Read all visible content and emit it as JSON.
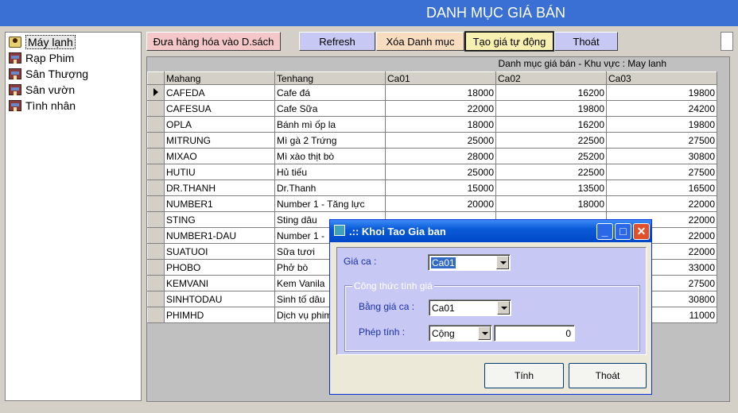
{
  "app": {
    "title": "DANH MỤC GIÁ BÁN"
  },
  "tree": {
    "items": [
      {
        "label": "Máy lạnh",
        "icon": "person-icon",
        "selected": true
      },
      {
        "label": "Rạp Phim",
        "icon": "house-icon"
      },
      {
        "label": "Sân Thượng",
        "icon": "house-icon"
      },
      {
        "label": "Sân vườn",
        "icon": "house-icon"
      },
      {
        "label": "Tình nhân",
        "icon": "house-icon"
      }
    ]
  },
  "toolbar": {
    "add_label": "Đưa hàng hóa vào D.sách",
    "refresh_label": "Refresh",
    "delete_label": "Xóa Danh mục",
    "auto_price_label": "Tạo giá tự động",
    "exit_label": "Thoát"
  },
  "grid": {
    "caption": "Danh mục giá bán - Khu vực : May lanh",
    "columns": [
      "Mahang",
      "Tenhang",
      "Ca01",
      "Ca02",
      "Ca03"
    ],
    "rows": [
      [
        "CAFEDA",
        "Cafe đá",
        "18000",
        "16200",
        "19800"
      ],
      [
        "CAFESUA",
        "Cafe Sữa",
        "22000",
        "19800",
        "24200"
      ],
      [
        "OPLA",
        "Bánh mì ốp la",
        "18000",
        "16200",
        "19800"
      ],
      [
        "MITRUNG",
        "Mì gà 2 Trứng",
        "25000",
        "22500",
        "27500"
      ],
      [
        "MIXAO",
        "Mì xào thịt bò",
        "28000",
        "25200",
        "30800"
      ],
      [
        "HUTIU",
        "Hủ tiếu",
        "25000",
        "22500",
        "27500"
      ],
      [
        "DR.THANH",
        "Dr.Thanh",
        "15000",
        "13500",
        "16500"
      ],
      [
        "NUMBER1",
        "Number 1 - Tăng lực",
        "20000",
        "18000",
        "22000"
      ],
      [
        "STING",
        "Sting dâu",
        "",
        "",
        "22000"
      ],
      [
        "NUMBER1-DAU",
        "Number 1 -",
        "",
        "",
        "22000"
      ],
      [
        "SUATUOI",
        "Sữa tươi",
        "",
        "",
        "22000"
      ],
      [
        "PHOBO",
        "Phở bò",
        "",
        "",
        "33000"
      ],
      [
        "KEMVANI",
        "Kem Vanila",
        "",
        "",
        "27500"
      ],
      [
        "SINHTODAU",
        "Sinh tố dâu",
        "",
        "",
        "30800"
      ],
      [
        "PHIMHD",
        "Dịch vụ phim",
        "",
        "",
        "11000"
      ]
    ]
  },
  "dialog": {
    "title": ".:: Khoi Tao Gia ban",
    "gia_ca_label": "Giá ca :",
    "gia_ca_value": "Ca01",
    "group_title": "Công thức tính giá",
    "bang_gia_label": "Bằng giá  ca :",
    "bang_gia_value": "Ca01",
    "phep_tinh_label": "Phép tính :",
    "phep_tinh_value": "Cộng",
    "amount_value": "0",
    "compute_label": "Tính",
    "exit_label": "Thoát"
  }
}
